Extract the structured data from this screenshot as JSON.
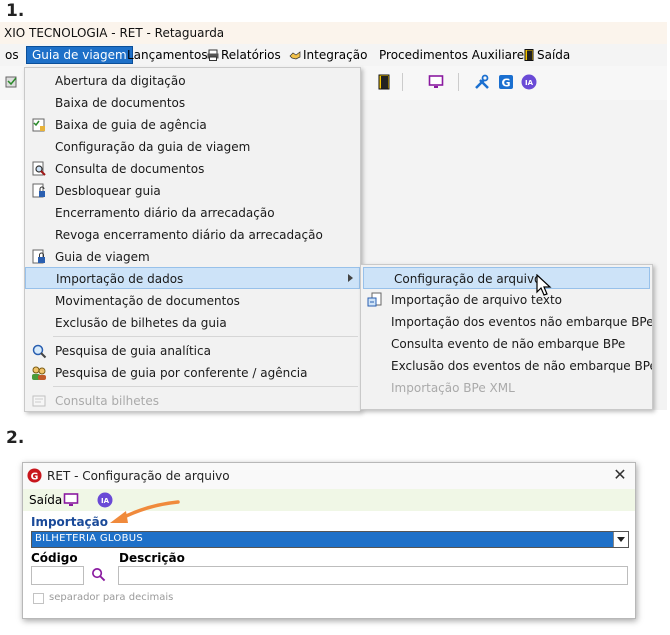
{
  "steps": {
    "one": "1.",
    "two": "2."
  },
  "app": {
    "title": "XIO TECNOLOGIA  - RET - Retaguarda"
  },
  "menubar": {
    "items": [
      {
        "label": "os"
      },
      {
        "label": "Guia de viagem"
      },
      {
        "label": "Lançamentos"
      },
      {
        "label": "Relatórios"
      },
      {
        "label": "Integração"
      },
      {
        "label": "Procedimentos Auxiliares"
      },
      {
        "label": "Saída"
      }
    ]
  },
  "dropdown": {
    "items": [
      {
        "label": "Abertura da digitação",
        "icon": ""
      },
      {
        "label": "Baixa de documentos",
        "icon": ""
      },
      {
        "label": "Baixa de guia de agência",
        "icon": "checklist-icon"
      },
      {
        "label": "Configuração da guia de viagem",
        "icon": ""
      },
      {
        "label": "Consulta de documentos",
        "icon": "magnifier-doc-icon"
      },
      {
        "label": "Desbloquear guia",
        "icon": "unlock-doc-icon"
      },
      {
        "label": "Encerramento diário da arrecadação",
        "icon": ""
      },
      {
        "label": "Revoga encerramento diário da arrecadação",
        "icon": ""
      },
      {
        "label": "Guia de viagem",
        "icon": "lock-doc-icon"
      },
      {
        "label": "Importação de dados",
        "icon": ""
      },
      {
        "label": "Movimentação de documentos",
        "icon": ""
      },
      {
        "label": "Exclusão de bilhetes da guia",
        "icon": ""
      },
      {
        "label": "Pesquisa de guia analítica",
        "icon": "search-icon"
      },
      {
        "label": "Pesquisa de guia por conferente / agência",
        "icon": "people-icon"
      },
      {
        "label": "Consulta bilhetes",
        "icon": "ticket-icon"
      }
    ]
  },
  "submenu": {
    "items": [
      {
        "label": "Configuração de arquivo"
      },
      {
        "label": "Importação de arquivo texto"
      },
      {
        "label": "Importação dos eventos não embarque BPe"
      },
      {
        "label": "Consulta evento de não embarque BPe"
      },
      {
        "label": "Exclusão dos eventos de não embarque BPe"
      },
      {
        "label": "Importação BPe XML"
      }
    ]
  },
  "dialog": {
    "title": "RET - Configuração de arquivo",
    "toolbar": {
      "exit": "Saída",
      "ia": "IA"
    },
    "importacao": {
      "label": "Importação",
      "value": "BILHETERIA GLOBUS"
    },
    "codigo": {
      "label": "Código",
      "value": ""
    },
    "descricao": {
      "label": "Descrição",
      "value": ""
    },
    "separator_checkbox": {
      "label": "separador para decimais",
      "checked": false
    }
  },
  "colors": {
    "accent": "#1e70c8",
    "highlight": "#cde3f8",
    "annotation_arrow": "#f08a3c",
    "label_blue": "#1a4a99"
  }
}
